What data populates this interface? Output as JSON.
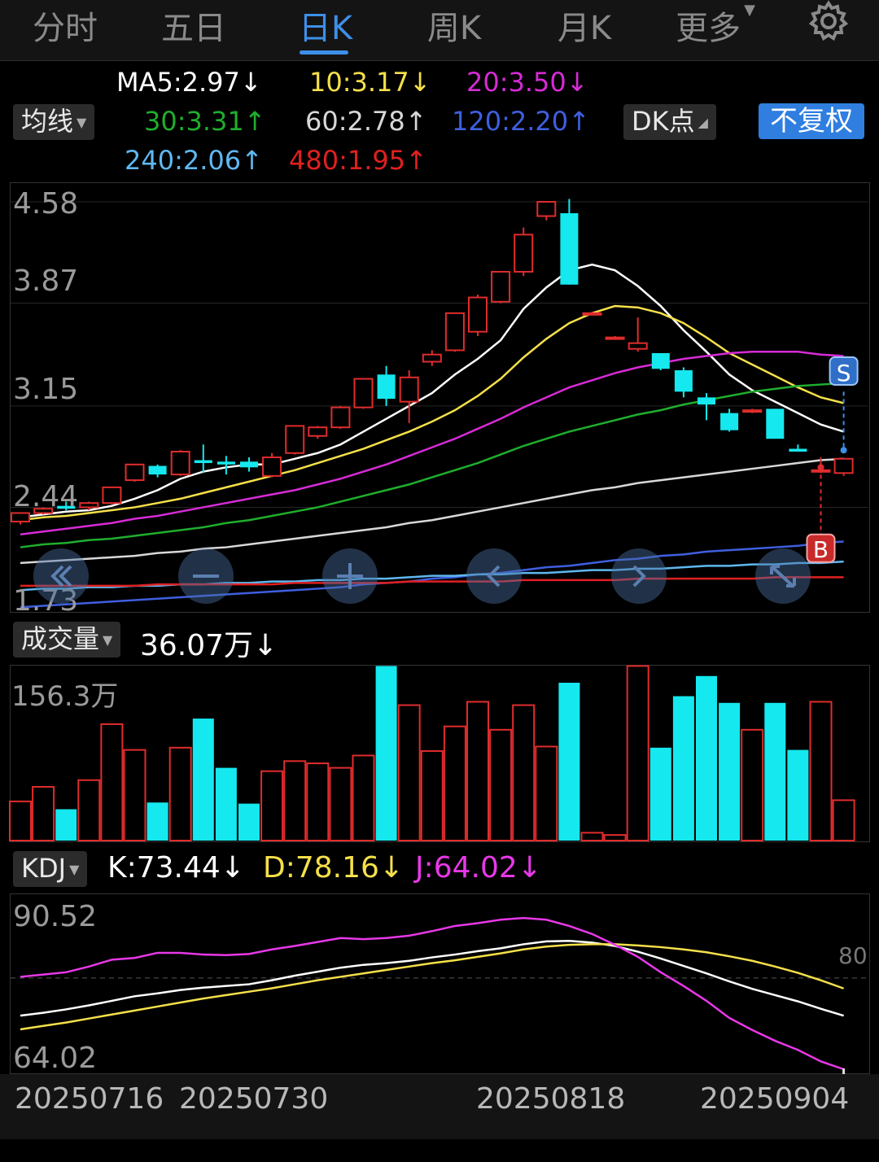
{
  "tabs": [
    {
      "label": "分时",
      "active": false
    },
    {
      "label": "五日",
      "active": false
    },
    {
      "label": "日K",
      "active": true
    },
    {
      "label": "周K",
      "active": false
    },
    {
      "label": "月K",
      "active": false
    },
    {
      "label": "更多",
      "active": false
    }
  ],
  "icons": {
    "settings": "gear-icon",
    "more_dropdown": "caret-down-icon"
  },
  "ma_bar": {
    "selector_label": "均线",
    "items": [
      {
        "text": "MA5:2.97↓",
        "color": "#ffffff"
      },
      {
        "text": "10:3.17↓",
        "color": "#f5e04a"
      },
      {
        "text": "20:3.50↓",
        "color": "#d62bd6"
      },
      {
        "text": "30:3.31↑",
        "color": "#1fae2d"
      },
      {
        "text": "60:2.78↑",
        "color": "#d8d8d8"
      },
      {
        "text": "120:2.20↑",
        "color": "#3f5fe0"
      },
      {
        "text": "240:2.06↑",
        "color": "#5fb8f0"
      },
      {
        "text": "480:1.95↑",
        "color": "#e02020"
      }
    ],
    "dk_label": "DK点",
    "adjust_label": "不复权"
  },
  "price_chart": {
    "y_labels": [
      "4.58",
      "3.87",
      "3.15",
      "2.44",
      "1.73"
    ],
    "sell_marker": "S",
    "buy_marker": "B"
  },
  "volume": {
    "selector_label": "成交量",
    "value_text": "36.07万↓",
    "max_label": "156.3万"
  },
  "kdj": {
    "selector_label": "KDJ",
    "k_text": "K:73.44↓",
    "d_text": "D:78.16↓",
    "j_text": "J:64.02↓",
    "top_label": "90.52",
    "bottom_label": "64.02",
    "ref_label": "80"
  },
  "dates": [
    "20250716",
    "20250730",
    "20250818",
    "20250904"
  ],
  "colors": {
    "up": "#e02c2c",
    "down": "#15e8ee",
    "accent": "#3d8fe8"
  },
  "chart_data": {
    "type": "candlestick",
    "categories": [
      "20250716",
      "",
      "",
      "",
      "",
      "",
      "",
      "",
      "",
      "",
      "20250730",
      "",
      "",
      "",
      "",
      "",
      "",
      "",
      "",
      "",
      "",
      "",
      "",
      "20250818",
      "",
      "",
      "",
      "",
      "",
      "",
      "",
      "",
      "",
      "",
      "20250904"
    ],
    "candles": [
      [
        2.34,
        2.4,
        2.32,
        2.4
      ],
      [
        2.4,
        2.44,
        2.39,
        2.43
      ],
      [
        2.45,
        2.48,
        2.42,
        2.43
      ],
      [
        2.44,
        2.48,
        2.42,
        2.47
      ],
      [
        2.47,
        2.58,
        2.46,
        2.58
      ],
      [
        2.63,
        2.74,
        2.62,
        2.74
      ],
      [
        2.73,
        2.74,
        2.65,
        2.67
      ],
      [
        2.67,
        2.84,
        2.66,
        2.83
      ],
      [
        2.77,
        2.88,
        2.68,
        2.75
      ],
      [
        2.76,
        2.8,
        2.67,
        2.74
      ],
      [
        2.76,
        2.79,
        2.69,
        2.72
      ],
      [
        2.66,
        2.82,
        2.65,
        2.79
      ],
      [
        2.82,
        3.01,
        2.81,
        3.01
      ],
      [
        2.94,
        3.01,
        2.92,
        3.0
      ],
      [
        3.0,
        3.15,
        2.99,
        3.14
      ],
      [
        3.14,
        3.34,
        3.13,
        3.34
      ],
      [
        3.37,
        3.43,
        3.15,
        3.2
      ],
      [
        3.18,
        3.4,
        3.03,
        3.35
      ],
      [
        3.46,
        3.54,
        3.43,
        3.51
      ],
      [
        3.54,
        3.8,
        3.53,
        3.8
      ],
      [
        3.67,
        3.93,
        3.64,
        3.91
      ],
      [
        3.88,
        4.09,
        3.87,
        4.09
      ],
      [
        4.09,
        4.4,
        4.06,
        4.35
      ],
      [
        4.48,
        4.57,
        4.45,
        4.58
      ],
      [
        4.5,
        4.6,
        4.0,
        4.0
      ],
      [
        3.8,
        3.81,
        3.79,
        3.8
      ],
      [
        3.63,
        3.64,
        3.62,
        3.63
      ],
      [
        3.55,
        3.77,
        3.53,
        3.59
      ],
      [
        3.52,
        3.52,
        3.4,
        3.41
      ],
      [
        3.4,
        3.42,
        3.21,
        3.25
      ],
      [
        3.21,
        3.24,
        3.05,
        3.16
      ],
      [
        3.1,
        3.13,
        2.97,
        2.98
      ],
      [
        3.11,
        3.13,
        3.1,
        3.12
      ],
      [
        3.13,
        3.13,
        2.93,
        2.92
      ],
      [
        2.85,
        2.88,
        2.83,
        2.83
      ],
      [
        2.7,
        2.79,
        2.68,
        2.7
      ],
      [
        2.68,
        2.74,
        2.66,
        2.78
      ]
    ],
    "volume": [
      35,
      48,
      28,
      54,
      104,
      81,
      34,
      83,
      109,
      65,
      33,
      62,
      71,
      69,
      65,
      76,
      156,
      121,
      80,
      102,
      124,
      99,
      121,
      84,
      141,
      7,
      5,
      156,
      83,
      129,
      147,
      123,
      99,
      123,
      81,
      124,
      36.07
    ],
    "y_range": [
      1.73,
      4.58
    ],
    "volume_max": 156.3,
    "kdj_range": [
      64.02,
      90.52
    ],
    "kdj_ref": 80,
    "ma_series": [
      {
        "name": "MA5",
        "color": "#ffffff",
        "values": [
          2.37,
          2.39,
          2.41,
          2.42,
          2.45,
          2.5,
          2.56,
          2.64,
          2.69,
          2.72,
          2.74,
          2.74,
          2.78,
          2.82,
          2.88,
          2.97,
          3.06,
          3.15,
          3.24,
          3.37,
          3.48,
          3.61,
          3.83,
          3.98,
          4.1,
          4.14,
          4.1,
          3.99,
          3.85,
          3.68,
          3.53,
          3.37,
          3.26,
          3.18,
          3.1,
          3.02,
          2.97
        ]
      },
      {
        "name": "10",
        "color": "#f5e04a",
        "values": [
          2.35,
          2.37,
          2.38,
          2.4,
          2.42,
          2.44,
          2.47,
          2.5,
          2.54,
          2.58,
          2.62,
          2.66,
          2.7,
          2.75,
          2.8,
          2.85,
          2.91,
          2.97,
          3.04,
          3.12,
          3.22,
          3.34,
          3.49,
          3.62,
          3.73,
          3.8,
          3.85,
          3.84,
          3.8,
          3.73,
          3.63,
          3.52,
          3.44,
          3.36,
          3.28,
          3.21,
          3.17
        ]
      },
      {
        "name": "20",
        "color": "#d62bd6",
        "values": [
          2.25,
          2.27,
          2.29,
          2.31,
          2.33,
          2.36,
          2.38,
          2.41,
          2.44,
          2.47,
          2.5,
          2.53,
          2.56,
          2.6,
          2.64,
          2.69,
          2.74,
          2.8,
          2.86,
          2.92,
          2.99,
          3.06,
          3.14,
          3.21,
          3.28,
          3.33,
          3.38,
          3.42,
          3.45,
          3.48,
          3.5,
          3.52,
          3.53,
          3.53,
          3.53,
          3.51,
          3.5
        ]
      },
      {
        "name": "30",
        "color": "#1fae2d",
        "values": [
          2.16,
          2.18,
          2.19,
          2.21,
          2.22,
          2.24,
          2.26,
          2.28,
          2.3,
          2.33,
          2.35,
          2.38,
          2.41,
          2.44,
          2.48,
          2.52,
          2.56,
          2.6,
          2.65,
          2.7,
          2.75,
          2.81,
          2.87,
          2.92,
          2.97,
          3.01,
          3.05,
          3.09,
          3.12,
          3.16,
          3.19,
          3.22,
          3.25,
          3.27,
          3.29,
          3.3,
          3.31
        ]
      },
      {
        "name": "60",
        "color": "#d8d8d8",
        "values": [
          2.05,
          2.06,
          2.07,
          2.08,
          2.09,
          2.1,
          2.12,
          2.13,
          2.15,
          2.16,
          2.18,
          2.2,
          2.22,
          2.24,
          2.26,
          2.28,
          2.3,
          2.33,
          2.35,
          2.38,
          2.41,
          2.44,
          2.47,
          2.5,
          2.53,
          2.56,
          2.58,
          2.61,
          2.63,
          2.65,
          2.67,
          2.69,
          2.71,
          2.73,
          2.75,
          2.77,
          2.78
        ]
      },
      {
        "name": "120",
        "color": "#3f5fe0",
        "values": [
          1.74,
          1.75,
          1.76,
          1.77,
          1.78,
          1.79,
          1.8,
          1.81,
          1.82,
          1.83,
          1.84,
          1.85,
          1.86,
          1.87,
          1.88,
          1.9,
          1.91,
          1.92,
          1.94,
          1.95,
          1.97,
          1.98,
          2.0,
          2.02,
          2.03,
          2.05,
          2.07,
          2.08,
          2.1,
          2.11,
          2.13,
          2.14,
          2.15,
          2.16,
          2.17,
          2.19,
          2.2
        ]
      },
      {
        "name": "240",
        "color": "#5fb8f0",
        "values": [
          1.86,
          1.87,
          1.87,
          1.88,
          1.88,
          1.89,
          1.89,
          1.9,
          1.9,
          1.91,
          1.91,
          1.92,
          1.92,
          1.93,
          1.93,
          1.94,
          1.94,
          1.95,
          1.96,
          1.96,
          1.97,
          1.97,
          1.98,
          1.98,
          1.99,
          2.0,
          2.0,
          2.01,
          2.01,
          2.02,
          2.03,
          2.03,
          2.04,
          2.04,
          2.05,
          2.05,
          2.06
        ]
      },
      {
        "name": "480",
        "color": "#e02020",
        "values": [
          1.89,
          1.89,
          1.89,
          1.89,
          1.89,
          1.89,
          1.9,
          1.9,
          1.9,
          1.9,
          1.9,
          1.9,
          1.91,
          1.91,
          1.91,
          1.91,
          1.91,
          1.92,
          1.92,
          1.92,
          1.92,
          1.92,
          1.93,
          1.93,
          1.93,
          1.93,
          1.93,
          1.94,
          1.94,
          1.94,
          1.94,
          1.94,
          1.94,
          1.95,
          1.95,
          1.95,
          1.95
        ]
      }
    ],
    "kdj_series": [
      {
        "name": "K",
        "color": "#ffffff",
        "values": [
          73.4,
          73.9,
          74.5,
          75.2,
          76.0,
          76.8,
          77.3,
          77.9,
          78.3,
          78.6,
          78.9,
          79.6,
          80.4,
          81.1,
          81.8,
          82.3,
          82.6,
          83.0,
          83.6,
          84.1,
          84.7,
          85.2,
          85.9,
          86.4,
          86.5,
          86.2,
          85.6,
          84.6,
          83.4,
          82.1,
          80.8,
          79.4,
          78.1,
          77.0,
          75.9,
          74.6,
          73.4
        ]
      },
      {
        "name": "D",
        "color": "#f5e04a",
        "values": [
          71.0,
          71.6,
          72.2,
          72.9,
          73.6,
          74.3,
          75.0,
          75.7,
          76.4,
          77.0,
          77.6,
          78.2,
          78.9,
          79.6,
          80.2,
          80.8,
          81.4,
          82.0,
          82.6,
          83.1,
          83.7,
          84.3,
          85.0,
          85.5,
          85.8,
          85.9,
          85.9,
          85.7,
          85.4,
          85.0,
          84.5,
          83.8,
          83.0,
          82.0,
          80.9,
          79.6,
          78.16
        ]
      },
      {
        "name": "J",
        "color": "#e838e8",
        "values": [
          80.2,
          80.6,
          81.0,
          82.0,
          83.2,
          83.5,
          84.4,
          84.4,
          84.1,
          84.0,
          84.2,
          85.0,
          85.6,
          86.3,
          87.0,
          86.8,
          87.0,
          87.4,
          88.2,
          89.1,
          89.6,
          90.2,
          90.5,
          90.2,
          89.1,
          87.7,
          85.8,
          83.7,
          81.0,
          78.6,
          76.0,
          73.0,
          70.9,
          69.0,
          67.4,
          65.4,
          64.02
        ]
      }
    ]
  }
}
